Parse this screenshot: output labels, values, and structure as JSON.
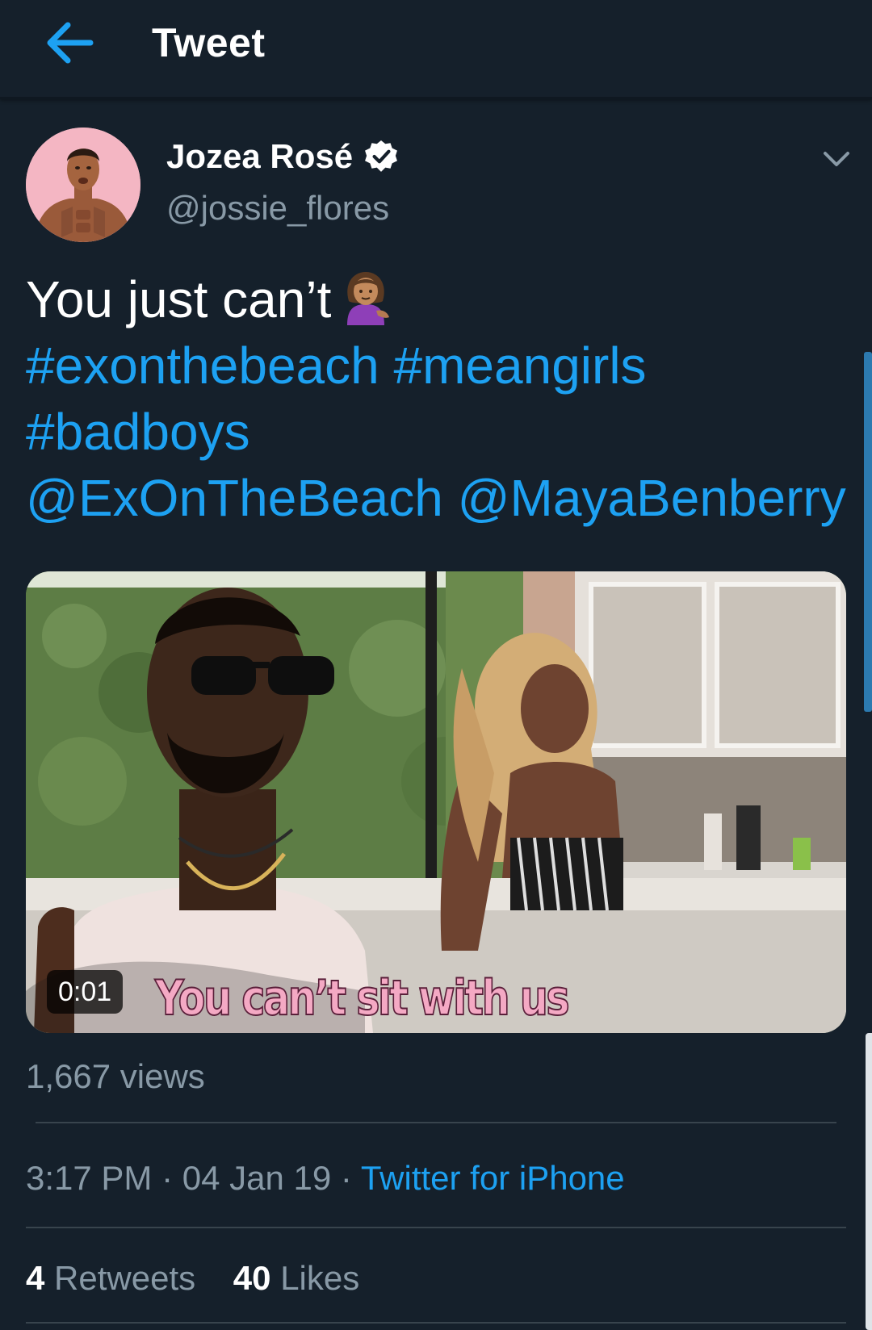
{
  "header": {
    "title": "Tweet",
    "back_icon": "arrow-left-icon"
  },
  "author": {
    "display_name": "Jozea Rosé",
    "handle": "@jossie_flores",
    "verified": true,
    "verified_icon": "verified-badge-icon"
  },
  "tweet": {
    "text_prefix": "You just can’t",
    "emoji": "woman-tipping-hand-emoji",
    "hashtags": [
      "#exonthebeach",
      "#meangirls",
      "#badboys"
    ],
    "mentions": [
      "@ExOnTheBeach",
      "@MayaBenberry"
    ]
  },
  "media": {
    "duration": "0:01",
    "caption": "You can’t sit with us"
  },
  "views": "1,667 views",
  "meta": {
    "time": "3:17 PM",
    "separator": " · ",
    "date": "04 Jan 19",
    "source": "Twitter for iPhone"
  },
  "stats": {
    "retweets_count": "4",
    "retweets_label": "Retweets",
    "likes_count": "40",
    "likes_label": "Likes"
  },
  "colors": {
    "background": "#15202b",
    "link": "#1da1f2",
    "secondary_text": "#8899a6",
    "divider": "#38444d"
  }
}
